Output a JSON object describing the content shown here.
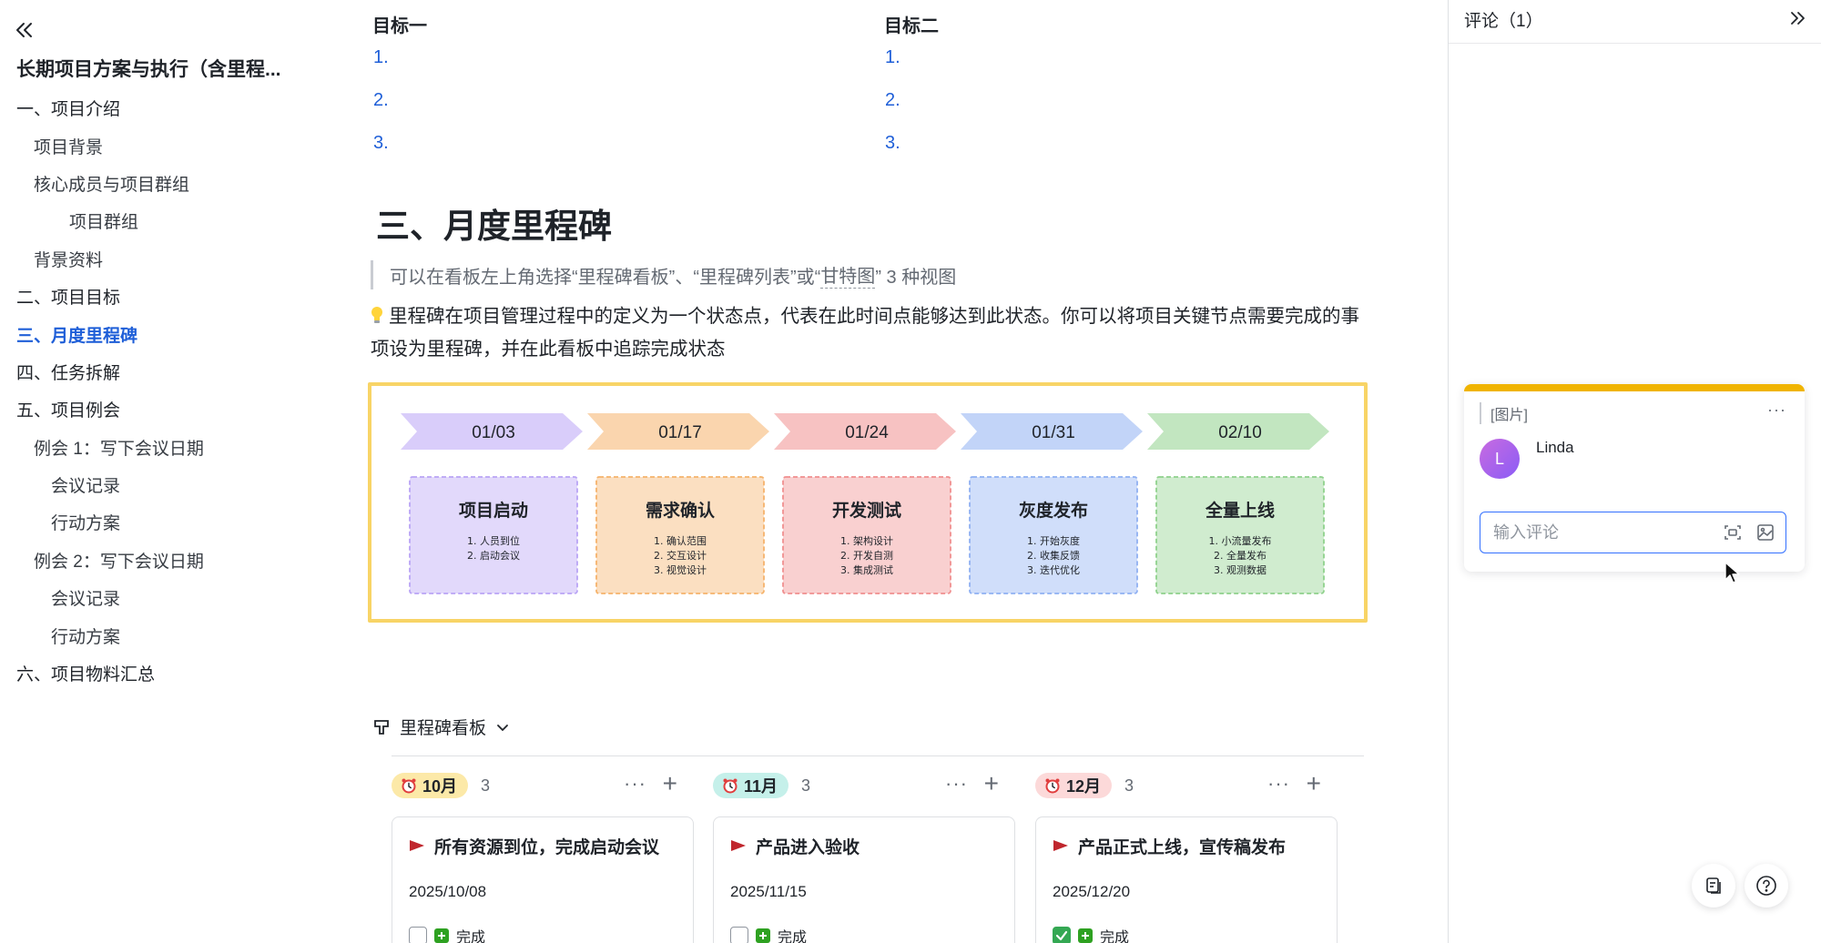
{
  "outline": {
    "doc_title": "长期项目方案与执行（含里程...",
    "items": [
      {
        "label": "一、项目介绍",
        "level": 1,
        "active": false
      },
      {
        "label": "项目背景",
        "level": 2,
        "active": false
      },
      {
        "label": "核心成员与项目群组",
        "level": 2,
        "active": false
      },
      {
        "label": "项目群组",
        "level": 4,
        "active": false
      },
      {
        "label": "背景资料",
        "level": 2,
        "active": false
      },
      {
        "label": "二、项目目标",
        "level": 1,
        "active": false
      },
      {
        "label": "三、月度里程碑",
        "level": 1,
        "active": true
      },
      {
        "label": "四、任务拆解",
        "level": 1,
        "active": false
      },
      {
        "label": "五、项目例会",
        "level": 1,
        "active": false
      },
      {
        "label": "例会 1：写下会议日期",
        "level": 2,
        "active": false
      },
      {
        "label": "会议记录",
        "level": 3,
        "active": false
      },
      {
        "label": "行动方案",
        "level": 3,
        "active": false
      },
      {
        "label": "例会 2：写下会议日期",
        "level": 2,
        "active": false
      },
      {
        "label": "会议记录",
        "level": 3,
        "active": false
      },
      {
        "label": "行动方案",
        "level": 3,
        "active": false
      },
      {
        "label": "六、项目物料汇总",
        "level": 1,
        "active": false
      }
    ]
  },
  "goals": {
    "goal1": {
      "heading": "目标一",
      "items": [
        "1.",
        "2.",
        "3."
      ]
    },
    "goal2": {
      "heading": "目标二",
      "items": [
        "1.",
        "2.",
        "3."
      ]
    }
  },
  "section": {
    "heading": "三、月度里程碑",
    "quote_prefix": "可以在看板左上角选择“里程碑看板”、“里程碑列表”或“",
    "quote_link": "甘特图",
    "quote_suffix": "” 3 种视图",
    "paragraph": "里程碑在项目管理过程中的定义为一个状态点，代表在此时间点能够达到此状态。你可以将项目关键节点需要完成的事项设为里程碑，并在此看板中追踪完成状态"
  },
  "milestone_image": {
    "stages": [
      {
        "date": "01/03",
        "title": "项目启动",
        "tasks": [
          "1. 人员到位",
          "2. 启动会议"
        ],
        "color": "#b9a4f5"
      },
      {
        "date": "01/17",
        "title": "需求确认",
        "tasks": [
          "1. 确认范围",
          "2. 交互设计",
          "3. 视觉设计"
        ],
        "color": "#f5b26b"
      },
      {
        "date": "01/24",
        "title": "开发测试",
        "tasks": [
          "1. 架构设计",
          "2. 开发自测",
          "3. 集成测试"
        ],
        "color": "#f08f8f"
      },
      {
        "date": "01/31",
        "title": "灰度发布",
        "tasks": [
          "1. 开始灰度",
          "2. 收集反馈",
          "3. 迭代优化"
        ],
        "color": "#8fb0f2"
      },
      {
        "date": "02/10",
        "title": "全量上线",
        "tasks": [
          "1. 小流量发布",
          "2. 全量发布",
          "3. 观测数据"
        ],
        "color": "#8fd18c"
      }
    ]
  },
  "kanban": {
    "view_label": "里程碑看板",
    "columns": [
      {
        "month": "10月",
        "count": "3",
        "tag_color": "#fce9a8",
        "card": {
          "title": "所有资源到位，完成启动会议",
          "date": "2025/10/08",
          "status": "完成",
          "checked": false
        }
      },
      {
        "month": "11月",
        "count": "3",
        "tag_color": "#c5f0ea",
        "card": {
          "title": "产品进入验收",
          "date": "2025/11/15",
          "status": "完成",
          "checked": false
        }
      },
      {
        "month": "12月",
        "count": "3",
        "tag_color": "#fcd9d9",
        "card": {
          "title": "产品正式上线，宣传稿发布",
          "date": "2025/12/20",
          "status": "完成",
          "checked": true
        }
      }
    ]
  },
  "comments_panel": {
    "title": "评论（1）",
    "comment": {
      "quote": "[图片]",
      "avatar_letter": "L",
      "user": "Linda",
      "input_placeholder": "输入评论"
    }
  },
  "colors": {
    "accent": "#1f5fd8",
    "comment_bar": "#f0b400",
    "image_border": "#f8d466"
  }
}
